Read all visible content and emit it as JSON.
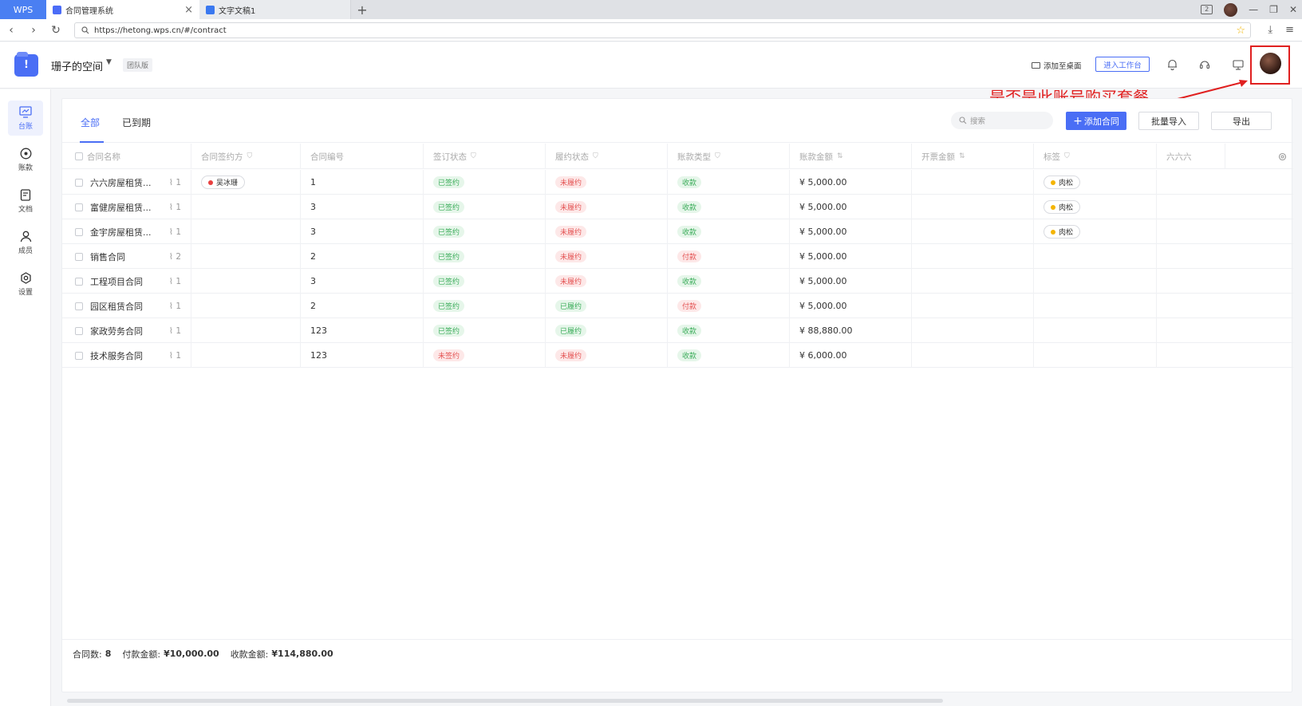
{
  "browser": {
    "wps_label": "WPS",
    "tabs": [
      {
        "label": "合同管理系统",
        "active": true
      },
      {
        "label": "文字文稿1",
        "active": false
      }
    ],
    "new_tab": "+",
    "url": "https://hetong.wps.cn/#/contract"
  },
  "header": {
    "space_title": "珊子的空间",
    "edition": "团队版",
    "add_desktop": "添加至桌面",
    "workbench": "进入工作台"
  },
  "annotation": {
    "text": "是否是此账号购买套餐",
    "color": "#e02020"
  },
  "sidebar": {
    "items": [
      {
        "label": "台账",
        "icon": "chart-icon",
        "active": true
      },
      {
        "label": "账款",
        "icon": "coin-icon",
        "active": false
      },
      {
        "label": "文档",
        "icon": "document-icon",
        "active": false
      },
      {
        "label": "成员",
        "icon": "user-icon",
        "active": false
      },
      {
        "label": "设置",
        "icon": "gear-icon",
        "active": false
      }
    ]
  },
  "tabs": [
    {
      "label": "全部",
      "active": true
    },
    {
      "label": "已到期",
      "active": false
    }
  ],
  "toolbar": {
    "search_placeholder": "搜索",
    "add_contract": "添加合同",
    "batch_import": "批量导入",
    "export": "导出"
  },
  "table": {
    "columns": [
      "合同名称",
      "合同签约方",
      "合同编号",
      "签订状态",
      "履约状态",
      "账款类型",
      "账款金额",
      "开票金额",
      "标签",
      "六六六"
    ],
    "rows": [
      {
        "name": "六六房屋租赁...",
        "attach": "1",
        "party": "吴冰珊",
        "party_color": "#e84040",
        "number": "1",
        "sign": "已签约",
        "sign_tone": "green",
        "perform": "未履约",
        "perform_tone": "red",
        "type": "收款",
        "type_tone": "green",
        "amount": "¥ 5,000.00",
        "invoice": "",
        "tag": "肉松",
        "tag_color": "#f4b400",
        "col10": ""
      },
      {
        "name": "富健房屋租赁...",
        "attach": "1",
        "party": "",
        "party_color": "",
        "number": "3",
        "sign": "已签约",
        "sign_tone": "green",
        "perform": "未履约",
        "perform_tone": "red",
        "type": "收款",
        "type_tone": "green",
        "amount": "¥ 5,000.00",
        "invoice": "",
        "tag": "肉松",
        "tag_color": "#f4b400",
        "col10": ""
      },
      {
        "name": "金宇房屋租赁...",
        "attach": "1",
        "party": "",
        "party_color": "",
        "number": "3",
        "sign": "已签约",
        "sign_tone": "green",
        "perform": "未履约",
        "perform_tone": "red",
        "type": "收款",
        "type_tone": "green",
        "amount": "¥ 5,000.00",
        "invoice": "",
        "tag": "肉松",
        "tag_color": "#f4b400",
        "col10": ""
      },
      {
        "name": "销售合同",
        "attach": "2",
        "party": "",
        "party_color": "",
        "number": "2",
        "sign": "已签约",
        "sign_tone": "green",
        "perform": "未履约",
        "perform_tone": "red",
        "type": "付款",
        "type_tone": "red",
        "amount": "¥ 5,000.00",
        "invoice": "",
        "tag": "",
        "tag_color": "",
        "col10": ""
      },
      {
        "name": "工程项目合同",
        "attach": "1",
        "party": "",
        "party_color": "",
        "number": "3",
        "sign": "已签约",
        "sign_tone": "green",
        "perform": "未履约",
        "perform_tone": "red",
        "type": "收款",
        "type_tone": "green",
        "amount": "¥ 5,000.00",
        "invoice": "",
        "tag": "",
        "tag_color": "",
        "col10": ""
      },
      {
        "name": "园区租赁合同",
        "attach": "1",
        "party": "",
        "party_color": "",
        "number": "2",
        "sign": "已签约",
        "sign_tone": "green",
        "perform": "已履约",
        "perform_tone": "green",
        "type": "付款",
        "type_tone": "red",
        "amount": "¥ 5,000.00",
        "invoice": "",
        "tag": "",
        "tag_color": "",
        "col10": ""
      },
      {
        "name": "家政劳务合同",
        "attach": "1",
        "party": "",
        "party_color": "",
        "number": "123",
        "sign": "已签约",
        "sign_tone": "green",
        "perform": "已履约",
        "perform_tone": "green",
        "type": "收款",
        "type_tone": "green",
        "amount": "¥ 88,880.00",
        "invoice": "",
        "tag": "",
        "tag_color": "",
        "col10": ""
      },
      {
        "name": "技术服务合同",
        "attach": "1",
        "party": "",
        "party_color": "",
        "number": "123",
        "sign": "未签约",
        "sign_tone": "red",
        "perform": "未履约",
        "perform_tone": "red",
        "type": "收款",
        "type_tone": "green",
        "amount": "¥ 6,000.00",
        "invoice": "",
        "tag": "",
        "tag_color": "",
        "col10": ""
      }
    ]
  },
  "footer": {
    "count_label": "合同数:",
    "count": "8",
    "pay_label": "付款金额:",
    "pay": "¥10,000.00",
    "receive_label": "收款金额:",
    "receive": "¥114,880.00"
  },
  "colors": {
    "accent": "#4a6ef5",
    "success": "#3cad5b",
    "danger": "#e45454"
  }
}
